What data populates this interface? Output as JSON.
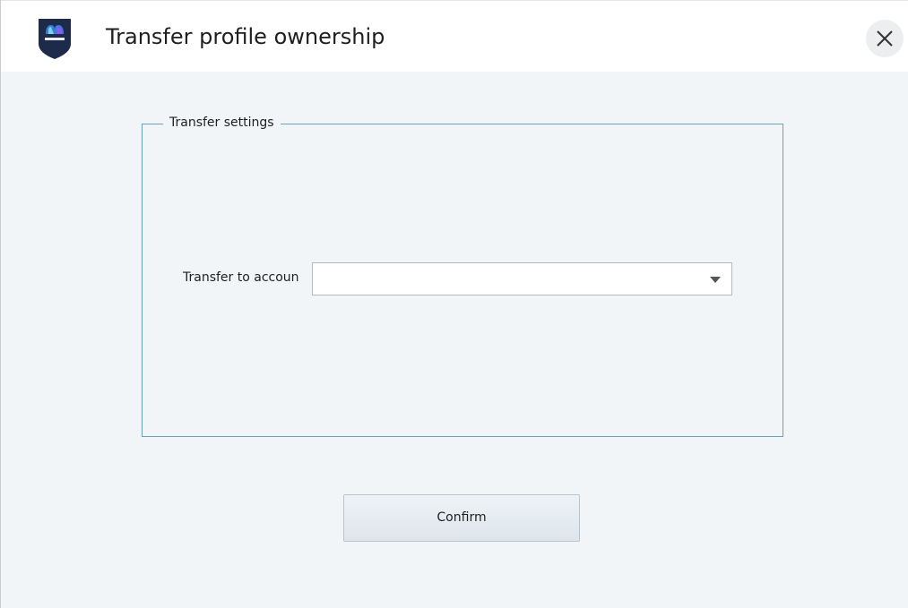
{
  "window": {
    "title": "Transfer profile ownership",
    "logo_icon": "shield-logo-icon",
    "close_icon": "close-icon"
  },
  "transfer_settings": {
    "legend": "Transfer settings",
    "account_label": "Transfer to accoun",
    "account_value": "",
    "dropdown_icon": "chevron-down-icon"
  },
  "actions": {
    "confirm_label": "Confirm"
  },
  "colors": {
    "background": "#f1f5f8",
    "titlebar": "#ffffff",
    "groupbox_border": "#6aa3b4",
    "logo_bg": "#1d2a4a"
  }
}
